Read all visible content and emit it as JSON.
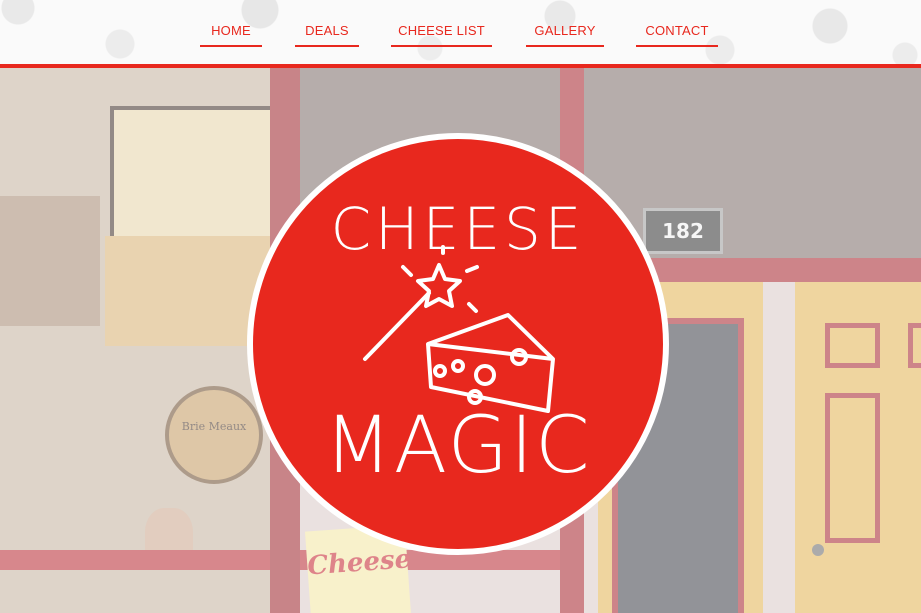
{
  "nav": {
    "items": [
      {
        "label": "HOME"
      },
      {
        "label": "DEALS"
      },
      {
        "label": "CHEESE LIST"
      },
      {
        "label": "GALLERY"
      },
      {
        "label": "CONTACT"
      }
    ]
  },
  "hero": {
    "door_number": "182",
    "window_sign": "Cheese",
    "plaque_text": "Brie Meaux"
  },
  "logo": {
    "top_text": "CHEESE",
    "bottom_text": "MAGIC"
  },
  "colors": {
    "accent": "#e8281e",
    "background": "#fafafa"
  },
  "icons": [
    "magic-wand-icon",
    "cheese-wedge-icon"
  ]
}
